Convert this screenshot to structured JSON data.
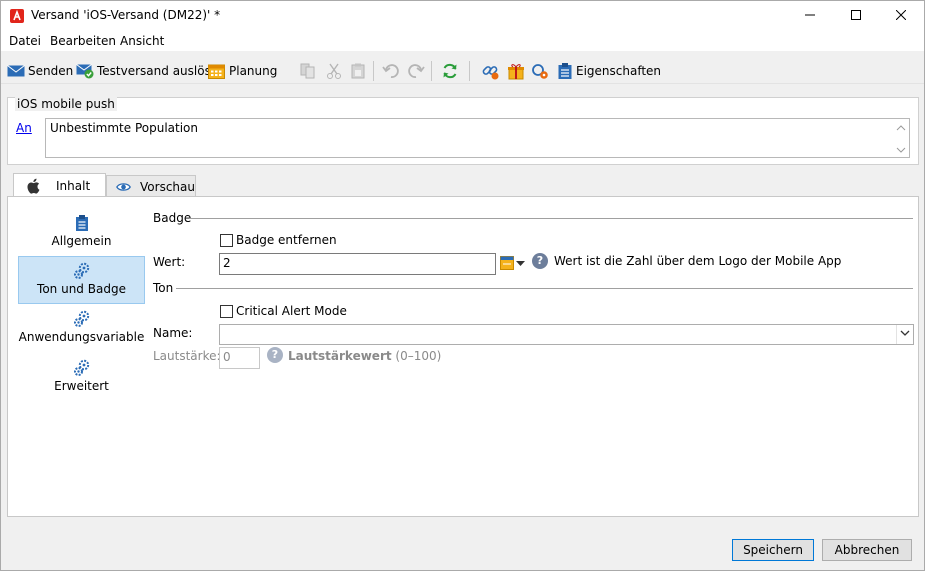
{
  "window": {
    "title": "Versand 'iOS-Versand (DM22)' *",
    "minimize": "—",
    "maximize": "☐",
    "close": "✕"
  },
  "menu": {
    "datei": "Datei",
    "bearbeiten": "Bearbeiten",
    "ansicht": "Ansicht"
  },
  "toolbar": {
    "senden": "Senden",
    "testversand": "Testversand auslösen",
    "planung": "Planung",
    "eigenschaften": "Eigenschaften"
  },
  "header": {
    "group_title": "iOS mobile push",
    "to_link": "An",
    "population": "Unbestimmte Population"
  },
  "tabs": [
    {
      "label": "Inhalt"
    },
    {
      "label": "Vorschau"
    }
  ],
  "nav": [
    {
      "label": "Allgemein"
    },
    {
      "label": "Ton und Badge"
    },
    {
      "label": "Anwendungsvariable"
    },
    {
      "label": "Erweitert"
    }
  ],
  "badge": {
    "section": "Badge",
    "remove_checkbox": "Badge entfernen",
    "remove_checked": false,
    "value_label": "Wert:",
    "value": "2",
    "help_text": "Wert ist die Zahl über dem Logo der Mobile App"
  },
  "sound": {
    "section": "Ton",
    "critical_checkbox": "Critical Alert Mode",
    "critical_checked": false,
    "name_label": "Name:",
    "name_value": "",
    "volume_label": "Lautstärke:",
    "volume_value": "0",
    "volume_help": "Lautstärkewert",
    "volume_range": "(0–100)"
  },
  "footer": {
    "save": "Speichern",
    "cancel": "Abbrechen"
  },
  "colors": {
    "accent": "#0078d7",
    "selection": "#cce4f7",
    "brand_red": "#e1251b",
    "help_blue": "#6d7e9b"
  }
}
